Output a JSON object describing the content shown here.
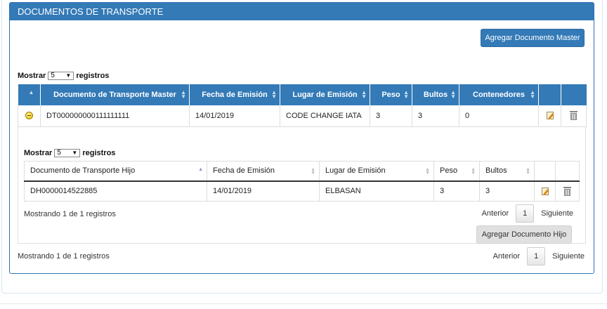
{
  "panel": {
    "title": "DOCUMENTOS DE TRANSPORTE",
    "add_master_label": "Agregar Documento Master"
  },
  "master_length": {
    "prefix": "Mostrar",
    "value": "5",
    "suffix": "registros"
  },
  "master_table": {
    "headers": [
      "Documento de Transporte Master",
      "Fecha de Emisión",
      "Lugar de Emisión",
      "Peso",
      "Bultos",
      "Contenedores"
    ],
    "rows": [
      {
        "documento": "DT000000000111111111",
        "fecha": "14/01/2019",
        "lugar": "CODE CHANGE IATA",
        "peso": "3",
        "bultos": "3",
        "contenedores": "0"
      }
    ]
  },
  "child_length": {
    "prefix": "Mostrar",
    "value": "5",
    "suffix": "registros"
  },
  "child_table": {
    "headers": [
      "Documento de Transporte Hijo",
      "Fecha de Emisión",
      "Lugar de Emisión",
      "Peso",
      "Bultos"
    ],
    "rows": [
      {
        "documento": "DH0000014522885",
        "fecha": "14/01/2019",
        "lugar": "ELBASAN",
        "peso": "3",
        "bultos": "3"
      }
    ]
  },
  "child_info": "Mostrando 1 de 1 registros",
  "child_pager": {
    "prev": "Anterior",
    "page": "1",
    "next": "Siguiente"
  },
  "add_child_label": "Agregar Documento Hijo",
  "master_info": "Mostrando 1 de 1 registros",
  "master_pager": {
    "prev": "Anterior",
    "page": "1",
    "next": "Siguiente"
  },
  "icons": {
    "expand": "minus-circle-icon",
    "edit": "edit-icon",
    "delete": "trash-icon"
  },
  "colors": {
    "primary": "#337ab7",
    "header_text": "#ffffff"
  }
}
